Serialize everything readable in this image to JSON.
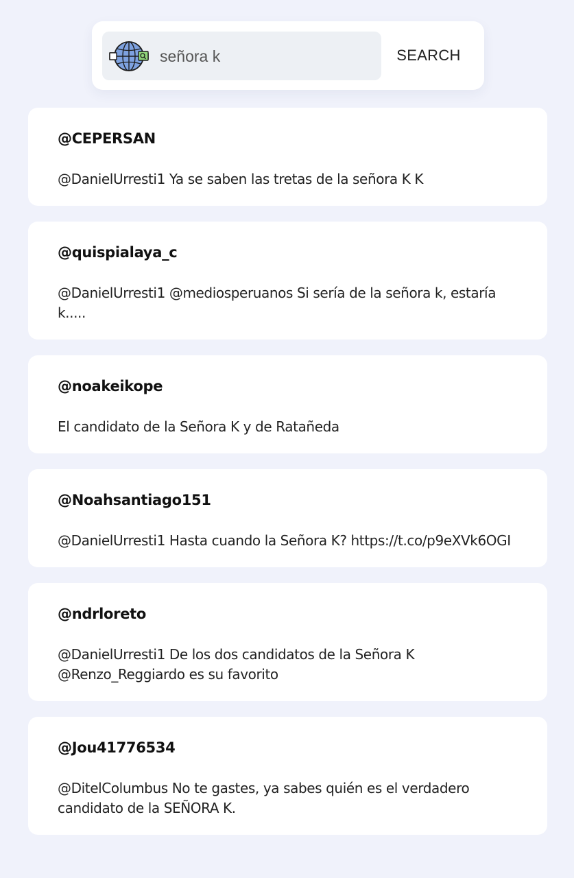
{
  "search": {
    "icon": "globe-search-icon",
    "query": "señora k",
    "button_label": "SEARCH"
  },
  "results": [
    {
      "user": "@CEPERSAN",
      "text": "@DanielUrresti1 Ya se saben las tretas de la señora K K"
    },
    {
      "user": "@quispialaya_c",
      "text": "@DanielUrresti1 @mediosperuanos Si sería de la señora k, estaría k....."
    },
    {
      "user": "@noakeikope",
      "text": "El candidato de la Señora K y de Ratañeda"
    },
    {
      "user": "@Noahsantiago151",
      "text": "@DanielUrresti1 Hasta cuando la Señora K? https://t.co/p9eXVk6OGI"
    },
    {
      "user": "@ndrloreto",
      "text": "@DanielUrresti1 De los dos candidatos de la Señora K @Renzo_Reggiardo es su favorito"
    },
    {
      "user": "@Jou41776534",
      "text": "@DitelColumbus No te gastes, ya sabes quién es el verdadero candidato de la SEÑORA K."
    }
  ],
  "colors": {
    "background": "#f0f2fb",
    "card": "#ffffff",
    "search_box": "#edf0f4",
    "globe": "#7ea2e0",
    "magnifier_badge": "#8fd47a"
  }
}
